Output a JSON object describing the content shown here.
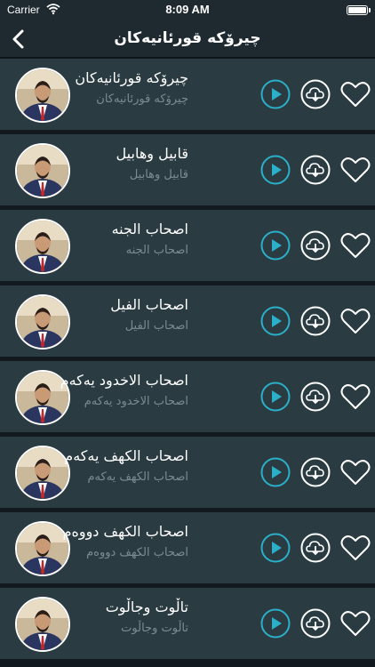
{
  "status": {
    "carrier": "Carrier",
    "time": "8:09 AM"
  },
  "nav": {
    "title": "چیرۆکە قورئانیەکان",
    "back_icon": "chevron-left-icon"
  },
  "colors": {
    "row_bg": "#2b3b42",
    "accent": "#2ab0c8",
    "nav_bg": "#1f2a30",
    "subtitle": "#7a8c92"
  },
  "tracks": [
    {
      "title": "چیرۆکە قورئانیەکان",
      "subtitle": "چیرۆکە قورئانیەکان"
    },
    {
      "title": "قابیل وهابیل",
      "subtitle": "قابیل وهابیل"
    },
    {
      "title": "اصحاب الجنه",
      "subtitle": "اصحاب الجنه"
    },
    {
      "title": "اصحاب الفیل",
      "subtitle": "اصحاب الفیل"
    },
    {
      "title": "اصحاب الاخدود یەکەم",
      "subtitle": "اصحاب الاخدود یەکەم"
    },
    {
      "title": "اصحاب الکهف یەکەم",
      "subtitle": "اصحاب الکهف یەکەم"
    },
    {
      "title": "اصحاب الکهف دووەم",
      "subtitle": "اصحاب الکهف دووەم"
    },
    {
      "title": "تاڵوت وجاڵوت",
      "subtitle": "تاڵوت وجاڵوت"
    }
  ],
  "row_icons": {
    "play": "play-icon",
    "download": "cloud-download-icon",
    "favorite": "heart-icon",
    "avatar": "reciter-avatar"
  }
}
